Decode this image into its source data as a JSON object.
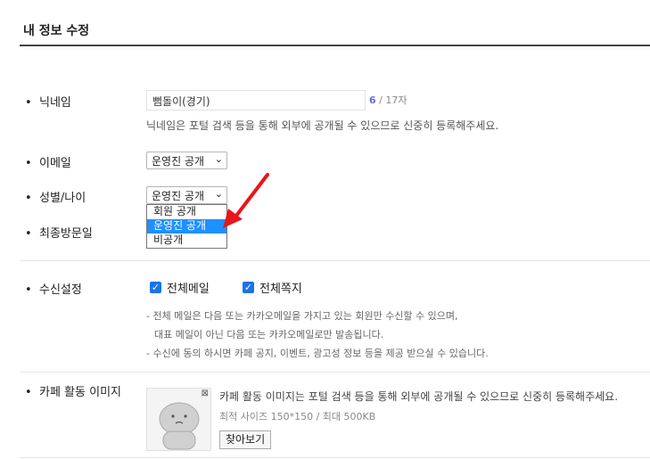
{
  "page": {
    "title": "내 정보 수정"
  },
  "nickname": {
    "label": "닉네임",
    "value": "뻠돌이(경기)",
    "count_current": "6",
    "count_sep": " / 17자",
    "help": "닉네임은 포털 검색 등을 통해 외부에 공개될 수 있으므로 신중히 등록해주세요."
  },
  "email": {
    "label": "이메일",
    "selected": "운영진 공개"
  },
  "gender_age": {
    "label": "성별/나이",
    "selected": "운영진 공개",
    "options": [
      "회원 공개",
      "운영진 공개",
      "비공개"
    ],
    "highlighted_option": "운영진 공개"
  },
  "last_visit": {
    "label": "최종방문일"
  },
  "receive": {
    "label": "수신설정",
    "mail_all": {
      "label": "전체메일",
      "checked": true
    },
    "note_all": {
      "label": "전체쪽지",
      "checked": true
    },
    "notes": [
      "- 전체 메일은 다음 또는 카카오메일을 가지고 있는 회원만 수신할 수 있으며,",
      "대표 메일이 아닌 다음 또는 카카오메일로만 발송됩니다.",
      "- 수신에 동의 하시면 카페 공지, 이벤트, 광고성 정보 등을 제공 받으실 수 있습니다."
    ]
  },
  "cafe_image": {
    "label": "카페 활동 이미지",
    "desc": "카페 활동 이미지는 포털 검색 등을 통해 외부에 공개될 수 있으므로 신중히 등록해주세요.",
    "size": "최적 사이즈 150*150 / 최대 500KB",
    "browse_label": "찾아보기"
  },
  "colors": {
    "accent": "#1a73e8",
    "highlight": "#1e90ff",
    "arrow": "#e8151b",
    "count": "#6a6ad8"
  }
}
